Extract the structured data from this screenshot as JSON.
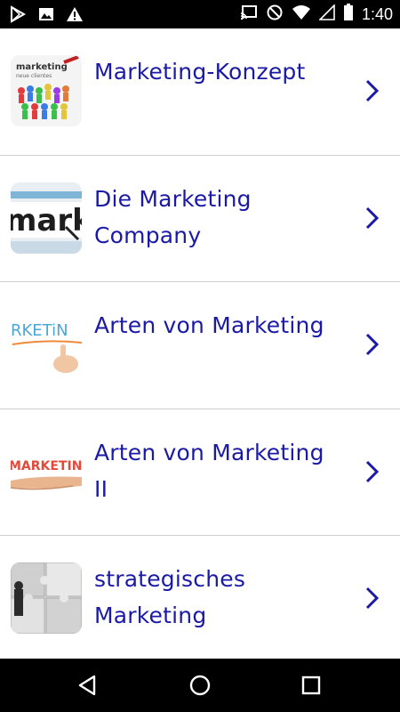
{
  "status_bar": {
    "time": "1:40",
    "left_icons": [
      "play-store-icon",
      "image-icon",
      "warning-icon"
    ],
    "right_icons": [
      "cast-icon",
      "do-not-disturb-icon",
      "wifi-icon",
      "signal-icon",
      "battery-icon"
    ]
  },
  "list": {
    "items": [
      {
        "title": "Marketing-Konzept",
        "thumb_text": "marketing",
        "thumb_subtext": "neue clientes"
      },
      {
        "title": "Die Marketing Company",
        "thumb_text": "mark"
      },
      {
        "title": "Arten von Marketing",
        "thumb_text": "RKETiN"
      },
      {
        "title": "Arten von Marketing II",
        "thumb_text": "MARKETING"
      },
      {
        "title": "strategisches Marketing"
      }
    ]
  },
  "nav_bar": {
    "buttons": [
      "back",
      "home",
      "recents"
    ]
  },
  "colors": {
    "title_text": "#1a1aa6",
    "chevron": "#1a1aa6",
    "divider": "#cfcfcf",
    "system_bars": "#000000"
  }
}
